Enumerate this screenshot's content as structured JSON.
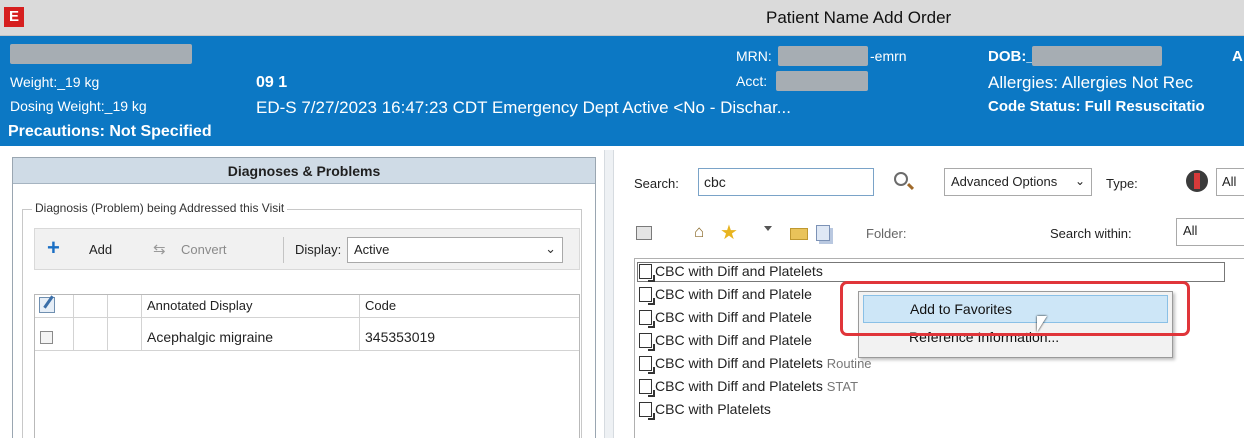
{
  "titlebar": {
    "app_letter": "E",
    "title": "Patient Name  Add Order"
  },
  "banner": {
    "weight": "Weight:_19 kg",
    "dosing_weight": "Dosing Weight:_19 kg",
    "precautions": "Precautions: Not Specified",
    "age_line": "09 1",
    "visit_info": "ED-S  7/27/2023 16:47:23 CDT  Emergency Dept  Active   <No - Dischar...",
    "mrn_label": "MRN:",
    "mrn_suffix": "-emrn",
    "acct_label": "Acct:",
    "dob_label": "DOB:_",
    "dob_extra": "A",
    "allergies": "Allergies: Allergies Not Rec",
    "code_status": "Code Status: Full Resuscitatio"
  },
  "diagnoses_panel": {
    "title": "Diagnoses & Problems",
    "group_label": "Diagnosis (Problem) being Addressed this Visit",
    "add_label": "Add",
    "convert_label": "Convert",
    "display_label": "Display:",
    "display_value": "Active",
    "columns": [
      "Annotated Display",
      "Code"
    ],
    "rows": [
      {
        "display": "Acephalgic migraine",
        "code": "345353019"
      }
    ]
  },
  "order_search": {
    "search_label": "Search:",
    "search_value": "cbc",
    "advanced_label": "Advanced Options",
    "type_label": "Type:",
    "type_value": "All",
    "folder_label": "Folder:",
    "search_within_label": "Search within:",
    "search_within_value": "All",
    "results": [
      {
        "name": "CBC with Diff and Platelets",
        "sub": ""
      },
      {
        "name": "CBC with Diff and Platele",
        "sub": ""
      },
      {
        "name": "CBC with Diff and Platele",
        "sub": ""
      },
      {
        "name": "CBC with Diff and Platele",
        "sub": ""
      },
      {
        "name": "CBC with Diff and Platelets",
        "sub": "Routine"
      },
      {
        "name": "CBC with Diff and Platelets",
        "sub": "STAT"
      },
      {
        "name": "CBC with Platelets",
        "sub": ""
      }
    ]
  },
  "context_menu": {
    "items": [
      "Add to Favorites",
      "Reference Information..."
    ]
  },
  "colors": {
    "banner_blue": "#0c78c4",
    "highlight_red": "#e0353a",
    "menu_hover": "#cde6f7"
  }
}
